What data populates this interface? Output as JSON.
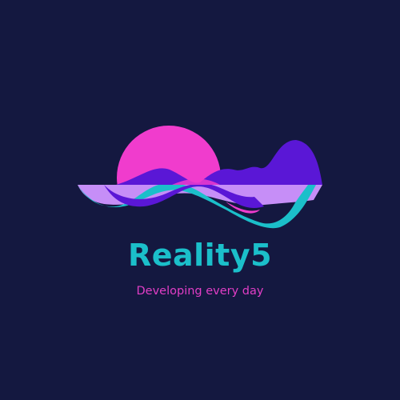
{
  "brand": {
    "name": "Reality5",
    "tagline": "Developing every day"
  },
  "colors": {
    "background": "#141840",
    "brand_teal": "#1bbfca",
    "tagline_magenta": "#e23ec6",
    "sun_pink": "#f03ccd",
    "wave_purple": "#5a17d6",
    "reflection_lilac": "#c68ef7"
  },
  "logo": {
    "icon": "sun-over-waves-icon"
  }
}
